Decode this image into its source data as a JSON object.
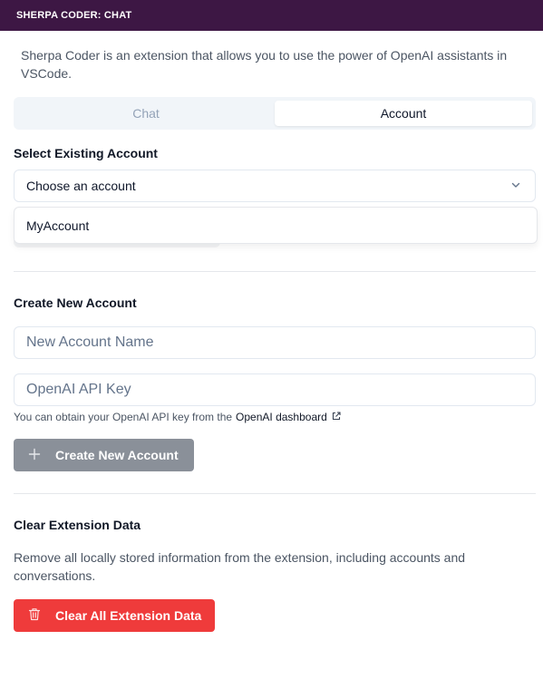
{
  "window": {
    "title": "SHERPA CODER: CHAT"
  },
  "intro": {
    "text": "Sherpa Coder is an extension that allows you to use the power of OpenAI assistants in VSCode."
  },
  "tabs": [
    {
      "label": "Chat",
      "active": false
    },
    {
      "label": "Account",
      "active": true
    }
  ],
  "select_existing": {
    "title": "Select Existing Account",
    "selected": "Choose an account",
    "options": [
      "MyAccount"
    ]
  },
  "create_new": {
    "title": "Create New Account",
    "name_placeholder": "New Account Name",
    "key_placeholder": "OpenAI API Key",
    "hint_text": "You can obtain your OpenAI API key from the",
    "hint_link": "OpenAI dashboard",
    "button_label": "Create New Account"
  },
  "clear_data": {
    "title": "Clear Extension Data",
    "description": "Remove all locally stored information from the extension, including accounts and conversations.",
    "button_label": "Clear All Extension Data"
  },
  "colors": {
    "titlebar": "#3d1744",
    "create_button": "#8a9099",
    "clear_button": "#ef3b3b"
  },
  "icons": [
    "chevron-down-icon",
    "external-link-icon",
    "plus-icon",
    "trash-icon"
  ]
}
